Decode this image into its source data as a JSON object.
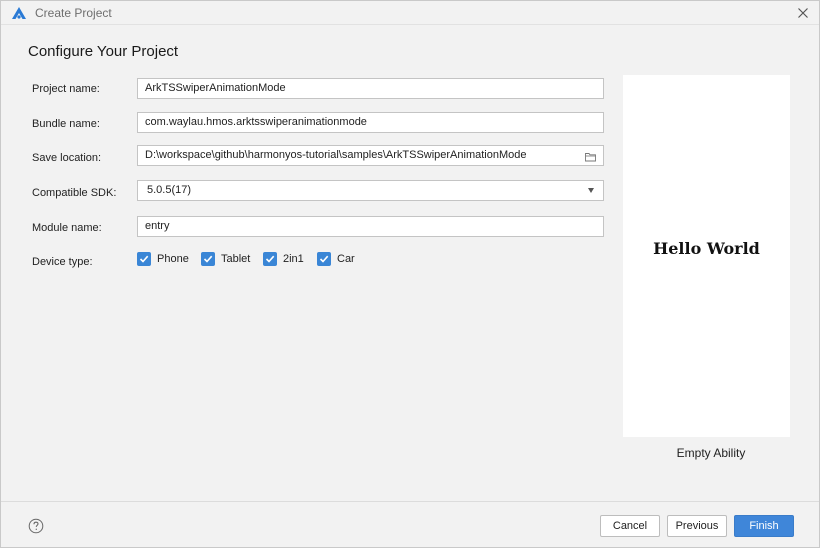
{
  "window": {
    "title": "Create Project"
  },
  "heading": "Configure Your Project",
  "form": {
    "project_name": {
      "label": "Project name:",
      "value": "ArkTSSwiperAnimationMode"
    },
    "bundle_name": {
      "label": "Bundle name:",
      "value": "com.waylau.hmos.arktsswiperanimationmode"
    },
    "save_location": {
      "label": "Save location:",
      "value": "D:\\workspace\\github\\harmonyos-tutorial\\samples\\ArkTSSwiperAnimationMode"
    },
    "compatible_sdk": {
      "label": "Compatible SDK:",
      "value": "5.0.5(17)"
    },
    "module_name": {
      "label": "Module name:",
      "value": "entry"
    },
    "device_type": {
      "label": "Device type:",
      "options": [
        {
          "label": "Phone",
          "checked": true
        },
        {
          "label": "Tablet",
          "checked": true
        },
        {
          "label": "2in1",
          "checked": true
        },
        {
          "label": "Car",
          "checked": true
        }
      ]
    }
  },
  "preview": {
    "text": "Hello World",
    "caption": "Empty Ability"
  },
  "footer": {
    "cancel_label": "Cancel",
    "previous_label": "Previous",
    "finish_label": "Finish"
  },
  "colors": {
    "accent": "#3f86d9",
    "checkbox": "#3a86d6",
    "window_bg": "#f2f2f2",
    "logo": "#2a7ad5"
  },
  "icons": {
    "app": "harmonyos-deveco-logo-icon",
    "close": "close-icon",
    "folder": "folder-icon",
    "dropdown": "chevron-down-icon",
    "help": "help-icon"
  }
}
